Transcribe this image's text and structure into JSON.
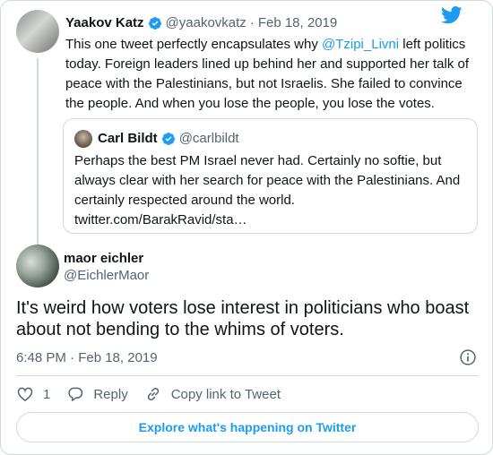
{
  "parent_tweet": {
    "name": "Yaakov Katz",
    "handle": "@yaakovkatz",
    "separator": "·",
    "date": "Feb 18, 2019",
    "text_before": "This one tweet perfectly encapsulates why ",
    "mention": "@Tzipi_Livni",
    "text_after": " left politics today. Foreign leaders lined up behind her and supported her talk of peace with the Palestinians, but not Israelis. She failed to convince the people. And when you lose the people, you lose the votes."
  },
  "quoted_tweet": {
    "name": "Carl Bildt",
    "handle": "@carlbildt",
    "text": "Perhaps the best PM Israel never had. Certainly no softie, but always clear with her search for peace with the Palestinians. And certainly respected around the world.",
    "link": "twitter.com/BarakRavid/sta…"
  },
  "main_tweet": {
    "name": "maor eichler",
    "handle": "@EichlerMaor",
    "text": "It's weird how voters lose interest in politicians who boast about not bending to the whims of voters.",
    "timestamp": "6:48 PM · Feb 18, 2019"
  },
  "actions": {
    "like_count": "1",
    "reply_label": "Reply",
    "copy_link_label": "Copy link to Tweet"
  },
  "explore_label": "Explore what's happening on Twitter",
  "icons": {
    "logo": "twitter-bird-icon",
    "verified": "verified-badge-icon",
    "info": "info-icon",
    "like": "heart-icon",
    "reply": "reply-bubble-icon",
    "copy_link": "link-icon"
  },
  "colors": {
    "accent": "#1d9bf0",
    "text": "#0f1419",
    "secondary": "#536471",
    "border": "#cfd9de"
  }
}
